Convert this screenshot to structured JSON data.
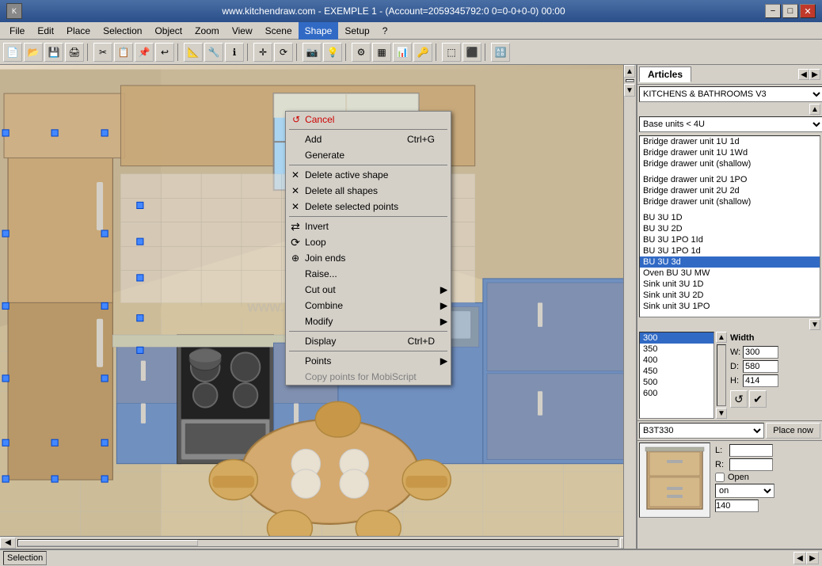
{
  "titlebar": {
    "title": "www.kitchendraw.com - EXEMPLE 1 - (Account=2059345792:0 0=0-0+0-0)  00:00",
    "minimize": "−",
    "maximize": "□",
    "close": "✕"
  },
  "menubar": {
    "items": [
      "File",
      "Edit",
      "Place",
      "Selection",
      "Object",
      "Zoom",
      "View",
      "Scene",
      "Shape",
      "Setup",
      "?"
    ]
  },
  "toolbar": {
    "buttons": [
      "📄",
      "💾",
      "🖨",
      "✂",
      "📋",
      "↩",
      "🔧",
      "📐",
      "ℹ",
      "✛",
      "⟳"
    ]
  },
  "context_menu": {
    "header": "↺ Cancel",
    "items": [
      {
        "label": "Add",
        "shortcut": "Ctrl+G",
        "disabled": false,
        "has_submenu": false,
        "icon": ""
      },
      {
        "label": "Generate",
        "shortcut": "",
        "disabled": false,
        "has_submenu": false,
        "icon": ""
      },
      {
        "separator": true
      },
      {
        "label": "Delete active shape",
        "shortcut": "",
        "disabled": false,
        "has_submenu": false,
        "icon": "✕"
      },
      {
        "label": "Delete all shapes",
        "shortcut": "",
        "disabled": false,
        "has_submenu": false,
        "icon": "✕"
      },
      {
        "label": "Delete selected points",
        "shortcut": "",
        "disabled": false,
        "has_submenu": false,
        "icon": "✕"
      },
      {
        "separator": true
      },
      {
        "label": "Invert",
        "shortcut": "",
        "disabled": false,
        "has_submenu": false,
        "icon": ""
      },
      {
        "label": "Loop",
        "shortcut": "",
        "disabled": false,
        "has_submenu": false,
        "icon": ""
      },
      {
        "label": "Join ends",
        "shortcut": "",
        "disabled": false,
        "has_submenu": false,
        "icon": ""
      },
      {
        "label": "Raise...",
        "shortcut": "",
        "disabled": false,
        "has_submenu": false,
        "icon": ""
      },
      {
        "label": "Cut out",
        "shortcut": "",
        "disabled": false,
        "has_submenu": true,
        "icon": ""
      },
      {
        "label": "Combine",
        "shortcut": "",
        "disabled": false,
        "has_submenu": true,
        "icon": ""
      },
      {
        "label": "Modify",
        "shortcut": "",
        "disabled": false,
        "has_submenu": true,
        "icon": ""
      },
      {
        "separator": true
      },
      {
        "label": "Display",
        "shortcut": "Ctrl+D",
        "disabled": false,
        "has_submenu": false,
        "icon": ""
      },
      {
        "separator": true
      },
      {
        "label": "Points",
        "shortcut": "",
        "disabled": false,
        "has_submenu": true,
        "icon": ""
      },
      {
        "label": "Copy points for MobiScript",
        "shortcut": "",
        "disabled": true,
        "has_submenu": false,
        "icon": ""
      }
    ]
  },
  "right_panel": {
    "tab": "Articles",
    "category_dropdown": "KITCHENS & BATHROOMS V3",
    "filter_dropdown": "Base units < 4U",
    "articles": [
      {
        "label": "Bridge drawer unit 1U 1d",
        "selected": false
      },
      {
        "label": "Bridge drawer unit 1U 1Wd",
        "selected": false
      },
      {
        "label": "Bridge drawer unit (shallow)",
        "selected": false
      },
      {
        "label": "",
        "gap": true
      },
      {
        "label": "Bridge drawer unit 2U 1PO",
        "selected": false
      },
      {
        "label": "Bridge drawer unit 2U 2d",
        "selected": false
      },
      {
        "label": "Bridge drawer unit (shallow)",
        "selected": false
      },
      {
        "label": "",
        "gap": true
      },
      {
        "label": "BU 3U 1D",
        "selected": false
      },
      {
        "label": "BU 3U 2D",
        "selected": false
      },
      {
        "label": "BU 3U 1PO 1Id",
        "selected": false
      },
      {
        "label": "BU 3U 1PO 1d",
        "selected": false
      },
      {
        "label": "BU 3U 3d",
        "selected": true
      },
      {
        "label": "Oven BU 3U MW",
        "selected": false
      },
      {
        "label": "Sink unit 3U 1D",
        "selected": false
      },
      {
        "label": "Sink unit 3U 2D",
        "selected": false
      },
      {
        "label": "Sink unit 3U 1PO",
        "selected": false
      }
    ],
    "dimensions": {
      "values": [
        "300",
        "350",
        "400",
        "450",
        "500",
        "600"
      ],
      "selected": "300"
    },
    "dim_header": "Width",
    "W": "300",
    "D": "580",
    "H": "414",
    "model_code": "B3T330",
    "place_btn": "Place now",
    "L_val": "",
    "R_val": "",
    "open_checked": false,
    "on_val": "on",
    "num_val": "140"
  },
  "statusbar": {
    "items": [
      "Selection",
      ""
    ]
  }
}
